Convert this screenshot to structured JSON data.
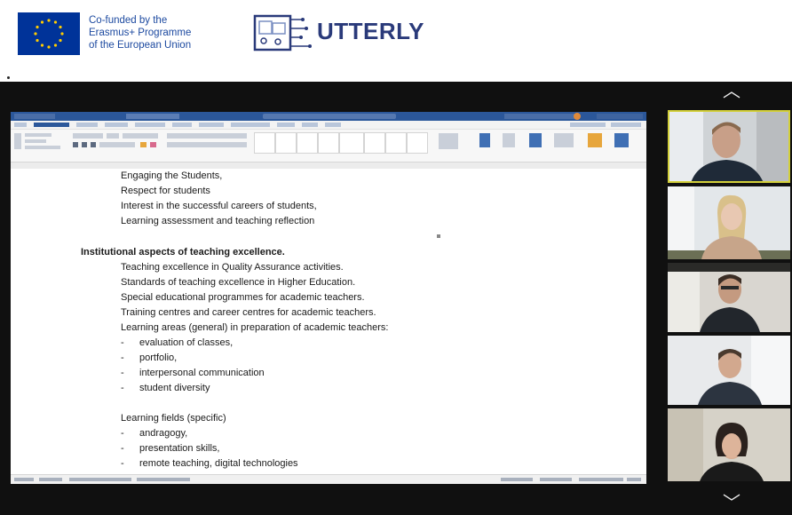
{
  "header": {
    "eu_text_lines": [
      "Co-funded by the",
      "Erasmus+ Programme",
      "of the European Union"
    ],
    "project_name": "UTTERLY",
    "eu_flag_color": "#003399",
    "eu_star_color": "#ffcc00",
    "project_text_color": "#2a3a7a"
  },
  "meeting": {
    "background": "#101010",
    "scroll_up_icon": "chevron-up-icon",
    "scroll_down_icon": "chevron-down-icon",
    "active_speaker_border": "#d3d03a",
    "participants": [
      {
        "name": "participant-1",
        "active": true
      },
      {
        "name": "participant-2",
        "active": false
      },
      {
        "name": "participant-3",
        "active": false
      },
      {
        "name": "participant-4",
        "active": false
      },
      {
        "name": "participant-5",
        "active": false
      }
    ]
  },
  "shared_document": {
    "app_accent": "#2b579a",
    "lines": [
      {
        "text": "Engaging the Students,",
        "indent": 1
      },
      {
        "text": "Respect for students",
        "indent": 1
      },
      {
        "text": "Interest in the successful careers of students,",
        "indent": 1
      },
      {
        "text": "Learning assessment and teaching reflection",
        "indent": 1
      },
      {
        "text": "",
        "indent": 0
      },
      {
        "text": "Institutional aspects of teaching excellence.",
        "indent": 0,
        "bold": true
      },
      {
        "text": "Teaching excellence in Quality Assurance activities.",
        "indent": 1
      },
      {
        "text": "Standards of teaching excellence in Higher Education.",
        "indent": 1
      },
      {
        "text": "Special educational programmes for academic teachers.",
        "indent": 1
      },
      {
        "text": "Training centres and career centres for academic teachers.",
        "indent": 1
      },
      {
        "text": "Learning areas (general) in preparation of academic teachers:",
        "indent": 1
      },
      {
        "text": "evaluation of classes,",
        "indent": 2,
        "bullet": "-"
      },
      {
        "text": "portfolio,",
        "indent": 2,
        "bullet": "-"
      },
      {
        "text": "interpersonal communication",
        "indent": 2,
        "bullet": "-"
      },
      {
        "text": "student diversity",
        "indent": 2,
        "bullet": "-"
      },
      {
        "text": "",
        "indent": 0
      },
      {
        "text": "Learning fields (specific)",
        "indent": 1
      },
      {
        "text": "andragogy,",
        "indent": 2,
        "bullet": "-"
      },
      {
        "text": "presentation skills,",
        "indent": 2,
        "bullet": "-"
      },
      {
        "text": "remote teaching, digital technologies",
        "indent": 2,
        "bullet": "-"
      }
    ]
  }
}
